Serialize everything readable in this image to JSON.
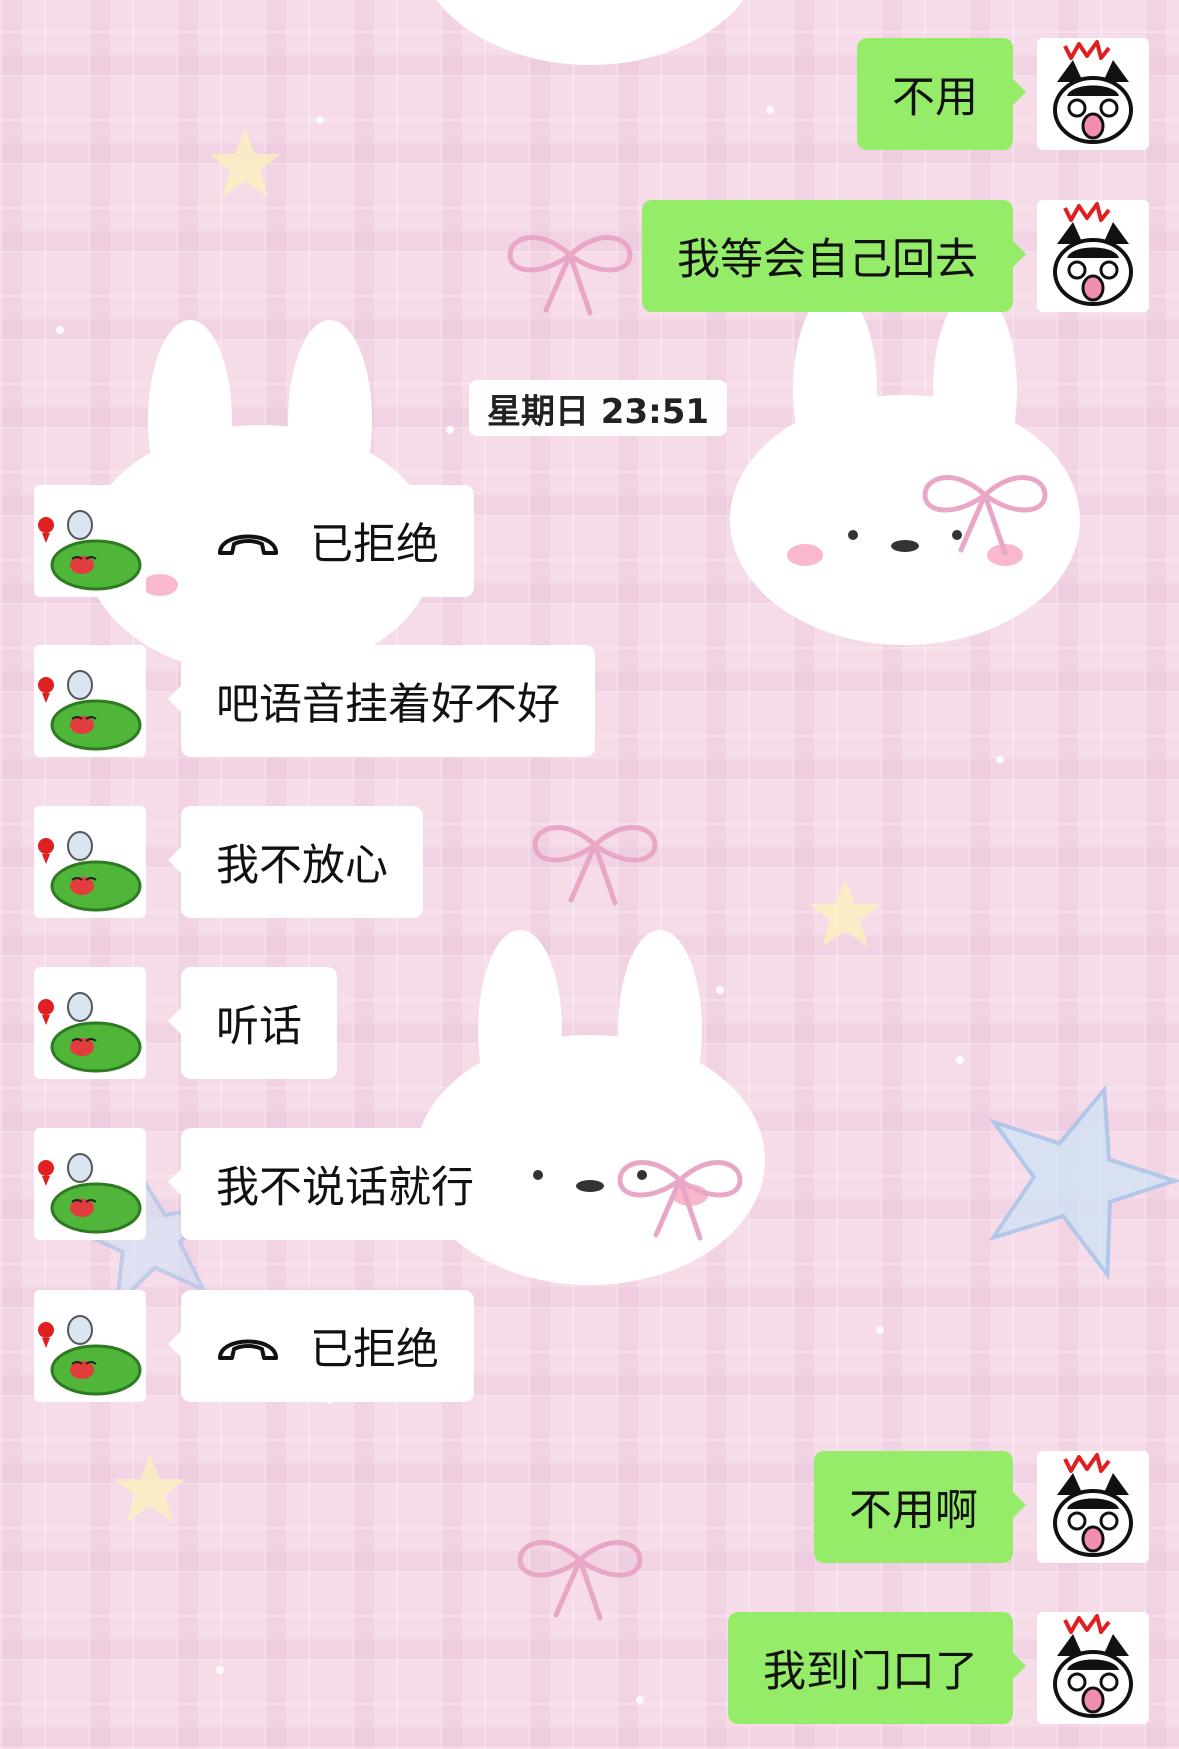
{
  "colors": {
    "background": "#f6dbe9",
    "outgoing_bubble": "#95ec69",
    "incoming_bubble": "#ffffff",
    "text": "#111111"
  },
  "timestamp": "星期日 23:51",
  "messages": [
    {
      "side": "out",
      "text": "不用",
      "avatar": "black-bunny-avatar-icon"
    },
    {
      "side": "out",
      "text": "我等会自己回去",
      "avatar": "black-bunny-avatar-icon"
    },
    {
      "side": "in",
      "type": "call",
      "text": "已拒绝",
      "icon": "phone-hangup-icon",
      "avatar": "green-frog-avatar-icon"
    },
    {
      "side": "in",
      "text": "吧语音挂着好不好",
      "avatar": "green-frog-avatar-icon"
    },
    {
      "side": "in",
      "text": "我不放心",
      "avatar": "green-frog-avatar-icon"
    },
    {
      "side": "in",
      "text": "听话",
      "avatar": "green-frog-avatar-icon"
    },
    {
      "side": "in",
      "text": "我不说话就行",
      "avatar": "green-frog-avatar-icon"
    },
    {
      "side": "in",
      "type": "call",
      "text": "已拒绝",
      "icon": "phone-hangup-icon",
      "avatar": "green-frog-avatar-icon"
    },
    {
      "side": "out",
      "text": "不用啊",
      "avatar": "black-bunny-avatar-icon"
    },
    {
      "side": "out",
      "text": "我到门口了",
      "avatar": "black-bunny-avatar-icon"
    }
  ]
}
